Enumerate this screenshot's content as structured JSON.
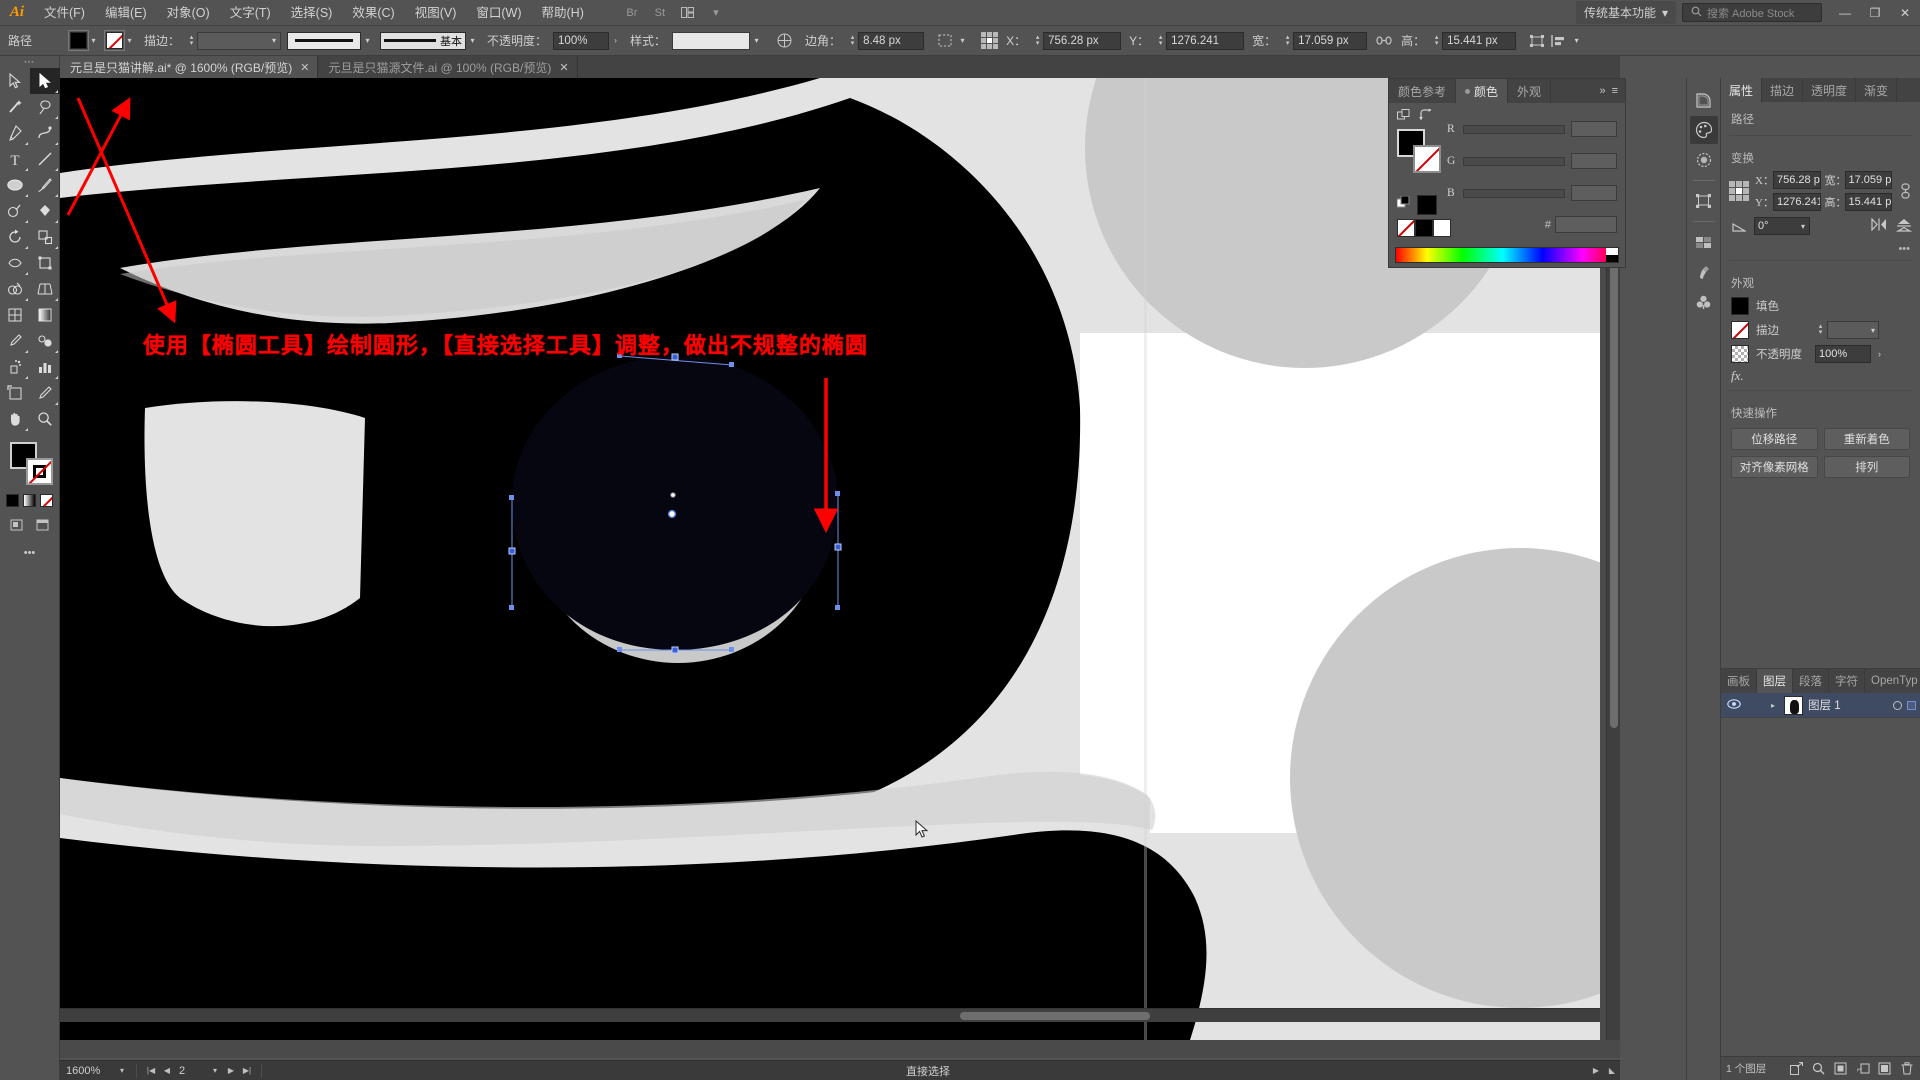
{
  "app": {
    "name": "Adobe Illustrator",
    "logo": "Ai"
  },
  "menubar": {
    "items": [
      {
        "label": "文件(F)",
        "name": "menu-file"
      },
      {
        "label": "编辑(E)",
        "name": "menu-edit"
      },
      {
        "label": "对象(O)",
        "name": "menu-object"
      },
      {
        "label": "文字(T)",
        "name": "menu-type"
      },
      {
        "label": "选择(S)",
        "name": "menu-select"
      },
      {
        "label": "效果(C)",
        "name": "menu-effect"
      },
      {
        "label": "视图(V)",
        "name": "menu-view"
      },
      {
        "label": "窗口(W)",
        "name": "menu-window"
      },
      {
        "label": "帮助(H)",
        "name": "menu-help"
      }
    ],
    "bridge_icon": "Br",
    "stock_icon": "St",
    "arrange_icon": "arrange-documents",
    "workspace": "传统基本功能",
    "search_placeholder": "搜索 Adobe Stock",
    "minimize": "—",
    "restore": "❐",
    "close": "✕"
  },
  "controlbar": {
    "object_type": "路径",
    "fill_label": "fill-swatch",
    "stroke_swatch_label": "stroke-swatch",
    "stroke_label": "描边：",
    "stroke_weight": "",
    "brush_name": "基本",
    "opacity_label": "不透明度：",
    "opacity_value": "100%",
    "style_label": "样式：",
    "corner_label": "边角：",
    "corner_value": "8.48 px",
    "x_label": "X：",
    "x_value": "756.28 px",
    "y_label": "Y：",
    "y_value": "1276.241",
    "w_label": "宽：",
    "w_value": "17.059 px",
    "h_label": "高：",
    "h_value": "15.441 px"
  },
  "tabs": [
    {
      "label": "元旦是只猫讲解.ai* @ 1600% (RGB/预览)",
      "active": true,
      "close": "✕"
    },
    {
      "label": "元旦是只猫源文件.ai @ 100% (RGB/预览)",
      "active": false,
      "close": "✕"
    }
  ],
  "toolbar": {
    "tools": [
      {
        "name": "selection-tool",
        "label": "选择工具",
        "active": false
      },
      {
        "name": "direct-selection-tool",
        "label": "直接选择工具",
        "active": true
      },
      {
        "name": "magic-wand-tool",
        "label": "魔棒工具",
        "active": false
      },
      {
        "name": "lasso-tool",
        "label": "套索工具",
        "active": false
      },
      {
        "name": "pen-tool",
        "label": "钢笔工具",
        "active": false
      },
      {
        "name": "curvature-tool",
        "label": "曲率工具",
        "active": false
      },
      {
        "name": "type-tool",
        "label": "文字工具",
        "active": false
      },
      {
        "name": "line-segment-tool",
        "label": "直线段工具",
        "active": false
      },
      {
        "name": "ellipse-tool",
        "label": "椭圆工具",
        "active": false
      },
      {
        "name": "paintbrush-tool",
        "label": "画笔工具",
        "active": false
      },
      {
        "name": "shaper-tool",
        "label": "Shaper 工具",
        "active": false
      },
      {
        "name": "blob-brush-tool",
        "label": "斑点画笔工具",
        "active": false
      },
      {
        "name": "rotate-tool",
        "label": "旋转工具",
        "active": false
      },
      {
        "name": "scale-tool",
        "label": "缩放工具",
        "active": false
      },
      {
        "name": "width-tool",
        "label": "宽度工具",
        "active": false
      },
      {
        "name": "free-transform-tool",
        "label": "自由变换工具",
        "active": false
      },
      {
        "name": "shape-builder-tool",
        "label": "形状生成器工具",
        "active": false
      },
      {
        "name": "perspective-grid-tool",
        "label": "透视网格工具",
        "active": false
      },
      {
        "name": "mesh-tool",
        "label": "网格工具",
        "active": false
      },
      {
        "name": "gradient-tool",
        "label": "渐变工具",
        "active": false
      },
      {
        "name": "eyedropper-tool",
        "label": "吸管工具",
        "active": false
      },
      {
        "name": "blend-tool",
        "label": "混合工具",
        "active": false
      },
      {
        "name": "symbol-sprayer-tool",
        "label": "符号喷枪工具",
        "active": false
      },
      {
        "name": "column-graph-tool",
        "label": "柱形图工具",
        "active": false
      },
      {
        "name": "artboard-tool",
        "label": "画板工具",
        "active": false
      },
      {
        "name": "slice-tool",
        "label": "切片工具",
        "active": false
      },
      {
        "name": "hand-tool",
        "label": "抓手工具",
        "active": false
      },
      {
        "name": "zoom-tool",
        "label": "缩放显示工具",
        "active": false
      }
    ],
    "fill_color": "#000000",
    "stroke_color": "none"
  },
  "color_panel": {
    "tabs": [
      {
        "label": "颜色参考",
        "active": false
      },
      {
        "label": "颜色",
        "active": true
      },
      {
        "label": "外观",
        "active": false
      }
    ],
    "expand_icon": "»",
    "menu_icon": "≡",
    "channels": [
      {
        "label": "R",
        "value": ""
      },
      {
        "label": "G",
        "value": ""
      },
      {
        "label": "B",
        "value": ""
      }
    ],
    "hex_label": "#",
    "hex_value": ""
  },
  "properties": {
    "tabs": [
      {
        "label": "属性",
        "active": true
      },
      {
        "label": "描边",
        "active": false
      },
      {
        "label": "透明度",
        "active": false
      },
      {
        "label": "渐变",
        "active": false
      }
    ],
    "object_title": "路径",
    "transform_title": "变换",
    "x_label": "X：",
    "x_value": "756.28 p",
    "y_label": "Y：",
    "y_value": "1276.241",
    "w_label": "宽：",
    "w_value": "17.059 p",
    "h_label": "高：",
    "h_value": "15.441 p",
    "angle_value": "0°",
    "appearance_title": "外观",
    "fill_label": "填色",
    "stroke_label": "描边",
    "opacity_label": "不透明度",
    "opacity_value": "100%",
    "fx_label": "fx.",
    "quick_actions_title": "快速操作",
    "quick_actions": [
      {
        "label": "位移路径",
        "name": "offset-path-button"
      },
      {
        "label": "重新着色",
        "name": "recolor-button"
      },
      {
        "label": "对齐像素网格",
        "name": "align-pixel-grid-button"
      },
      {
        "label": "排列",
        "name": "arrange-button"
      }
    ],
    "more_dots": "•••"
  },
  "layers_panel": {
    "tabs": [
      {
        "label": "画板",
        "active": false
      },
      {
        "label": "图层",
        "active": true
      },
      {
        "label": "段落",
        "active": false
      },
      {
        "label": "字符",
        "active": false
      },
      {
        "label": "OpenTyp",
        "active": false
      }
    ],
    "menu_icon": "≡",
    "rows": [
      {
        "name": "图层 1",
        "visible": true,
        "selected": true
      }
    ],
    "footer_count": "1 个图层",
    "footer_icons": [
      "collect-for-export",
      "locate-object",
      "make-clipping-mask",
      "create-new-sublayer",
      "create-new-layer",
      "delete-selection"
    ]
  },
  "statusbar": {
    "zoom": "1600%",
    "artboard_number": "2",
    "tool_name": "直接选择"
  },
  "annotation": {
    "text": "使用【椭圆工具】绘制圆形，【直接选择工具】调整，做出不规整的椭圆",
    "color": "#ff0000",
    "arrows": 3
  },
  "canvas": {
    "artwork_description": "黑白猫插画局部，选中的不规整椭圆",
    "black": "#000000",
    "light_gray": "#d8d8d8",
    "mid_gray": "#c0c0c0",
    "white": "#ffffff",
    "selection_blue": "#5a7fe0"
  }
}
